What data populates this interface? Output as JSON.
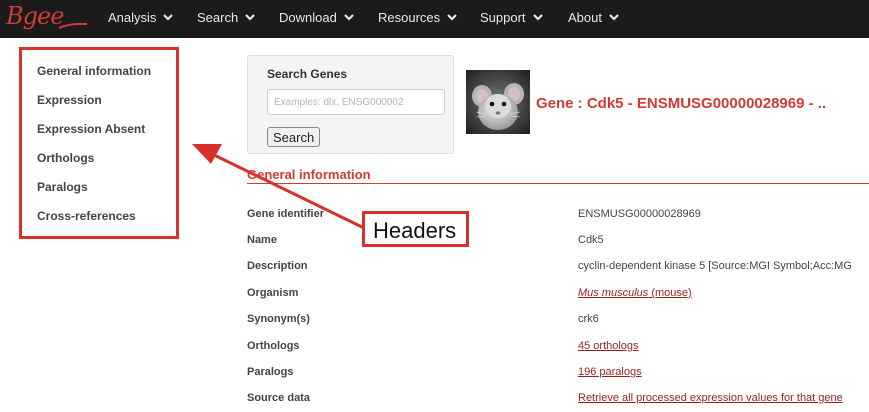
{
  "brand": {
    "logo_text": "Bgee",
    "logo_color": "#d03c34",
    "topbar_color": "#1b1b1b"
  },
  "nav": [
    {
      "label": "Analysis"
    },
    {
      "label": "Search"
    },
    {
      "label": "Download"
    },
    {
      "label": "Resources"
    },
    {
      "label": "Support"
    },
    {
      "label": "About"
    }
  ],
  "sidebar": {
    "items": [
      {
        "label": "General information"
      },
      {
        "label": "Expression"
      },
      {
        "label": "Expression Absent"
      },
      {
        "label": "Orthologs"
      },
      {
        "label": "Paralogs"
      },
      {
        "label": "Cross-references"
      }
    ]
  },
  "search": {
    "title": "Search Genes",
    "placeholder": "Examples: dlx, ENSG000002",
    "button_label": "Search"
  },
  "gene": {
    "title": "Gene : Cdk5 - ENSMUSG00000028969 - ..",
    "image": "mouse-photo"
  },
  "general_info": {
    "section_title": "General information",
    "rows": [
      {
        "label": "Gene identifier",
        "value": "ENSMUSG00000028969"
      },
      {
        "label": "Name",
        "value": "Cdk5"
      },
      {
        "label": "Description",
        "value": "cyclin-dependent kinase 5 [Source:MGI Symbol;Acc:MG"
      },
      {
        "label": "Organism",
        "value_italic": "Mus musculus",
        "value_rest": " (mouse)"
      },
      {
        "label": "Synonym(s)",
        "value": "crk6"
      },
      {
        "label": "Orthologs",
        "value": "45 orthologs"
      },
      {
        "label": "Paralogs",
        "value": "196 paralogs"
      },
      {
        "label": "Source data",
        "value": "Retrieve all processed expression values for that gene"
      }
    ]
  },
  "annotation": {
    "label": "Headers",
    "color": "#d9312a"
  }
}
